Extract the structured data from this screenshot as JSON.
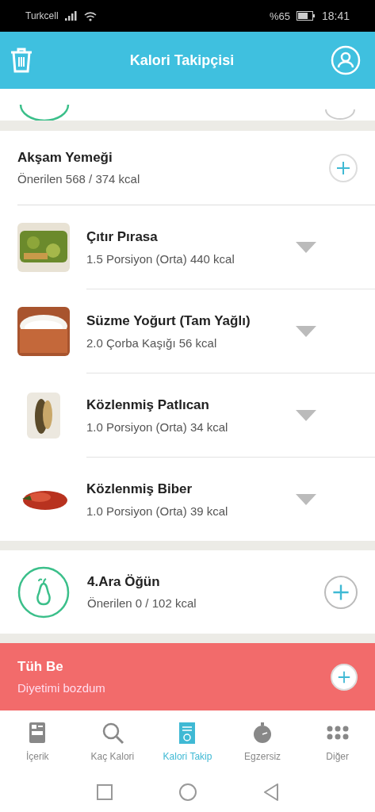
{
  "status_bar": {
    "carrier": "Turkcell",
    "battery": "%65",
    "time": "18:41"
  },
  "header": {
    "title": "Kalori Takipçisi"
  },
  "meal": {
    "title": "Akşam Yemeği",
    "summary": "Önerilen 568 / 374 kcal",
    "foods": [
      {
        "name": "Çıtır Pırasa",
        "portion": "1.5 Porsiyon (Orta) 440 kcal",
        "kind": "picture"
      },
      {
        "name": "Süzme Yoğurt (Tam Yağlı)",
        "portion": "2.0 Çorba Kaşığı 56 kcal",
        "kind": "picture"
      },
      {
        "name": "Közlenmiş Patlıcan",
        "portion": "1.0 Porsiyon (Orta) 34 kcal",
        "kind": "picture"
      },
      {
        "name": "Közlenmiş Biber",
        "portion": "1.0 Porsiyon (Orta) 39 kcal",
        "kind": "picture"
      }
    ]
  },
  "snack": {
    "title": "4.Ara Öğün",
    "summary": "Önerilen 0 / 102 kcal"
  },
  "cheat": {
    "title": "Tüh Be",
    "summary": "Diyetimi bozdum"
  },
  "tabs": [
    {
      "label": "İçerik",
      "kind": "content",
      "selected": false
    },
    {
      "label": "Kaç Kalori",
      "kind": "search",
      "selected": false
    },
    {
      "label": "Kalori Takip",
      "kind": "tracker",
      "selected": true
    },
    {
      "label": "Egzersiz",
      "kind": "exercise",
      "selected": false
    },
    {
      "label": "Diğer",
      "kind": "more",
      "selected": false
    }
  ]
}
